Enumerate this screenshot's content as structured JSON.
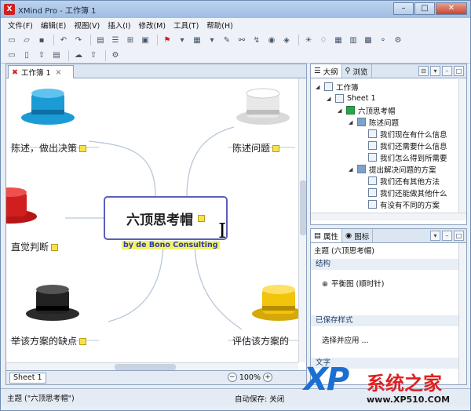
{
  "window": {
    "title": "XMind Pro - 工作簿 1",
    "app_badge": "X"
  },
  "menu": [
    "文件(F)",
    "编辑(E)",
    "视图(V)",
    "插入(I)",
    "修改(M)",
    "工具(T)",
    "帮助(H)"
  ],
  "editor": {
    "tab_label": "工作簿 1",
    "sheet_tab": "Sheet 1",
    "zoom": "100%"
  },
  "mindmap": {
    "central_topic": "六顶思考帽",
    "central_subtitle": "by de Bono Consulting",
    "topics": {
      "top_left": "陈述，做出决策",
      "top_right": "陈述问题",
      "mid_left": "直觉判断",
      "bottom_left": "举该方案的缺点",
      "bottom_right": "评估该方案的"
    },
    "hat_colors": {
      "top_left": "#1a9bd6",
      "top_right": "#e8e8e8",
      "mid_left": "#d11f1f",
      "bottom_left": "#222222",
      "bottom_right": "#f2c40b"
    }
  },
  "outline_panel": {
    "tabs": [
      "大纲",
      "浏览"
    ],
    "tree": [
      {
        "label": "工作簿",
        "level": 0
      },
      {
        "label": "Sheet 1",
        "level": 1
      },
      {
        "label": "六顶思考帽",
        "level": 2
      },
      {
        "label": "陈述问题",
        "level": 3
      },
      {
        "label": "我们现在有什么信息",
        "level": 4
      },
      {
        "label": "我们还需要什么信息",
        "level": 4
      },
      {
        "label": "我们怎么得到所需要",
        "level": 4
      },
      {
        "label": "提出解决问题的方案",
        "level": 3
      },
      {
        "label": "我们还有其他方法",
        "level": 4
      },
      {
        "label": "我们还能做其他什么",
        "level": 4
      },
      {
        "label": "有没有不同的方案",
        "level": 4
      }
    ]
  },
  "properties_panel": {
    "tabs": [
      "属性",
      "图标"
    ],
    "topic_line": "主题 (六顶思考帽)",
    "structure_head": "结构",
    "structure_value": "平衡图 (顺时针)",
    "saved_styles_head": "已保存样式",
    "saved_styles_value": "选择并应用 ...",
    "text_head": "文字"
  },
  "status": {
    "topic": "主题 (\"六顶思考帽\")",
    "autosave": "自动保存: 关闭"
  },
  "watermark": {
    "xp": "XP",
    "cn": "系统之家",
    "url": "www.XP510.COM"
  }
}
